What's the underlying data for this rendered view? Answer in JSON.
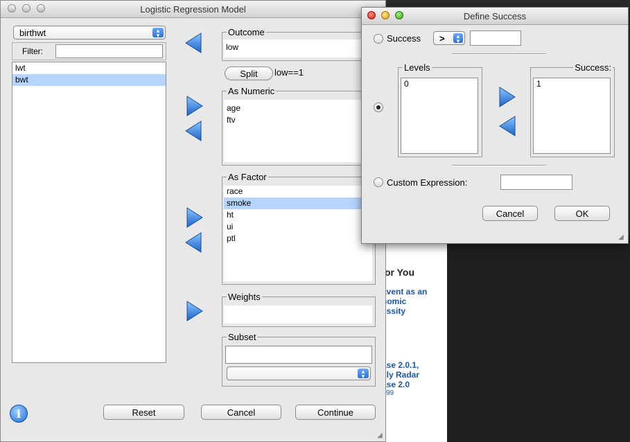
{
  "main_window": {
    "title": "Logistic Regression Model",
    "dataset": "birthwt",
    "filter_label": "Filter:",
    "filter_value": "",
    "variables": [
      "lwt",
      "bwt"
    ],
    "selected_variable": "bwt",
    "outcome": {
      "label": "Outcome",
      "value": "low"
    },
    "split_button": "Split",
    "split_text": "low==1",
    "as_numeric": {
      "label": "As Numeric",
      "items": [
        "age",
        "ftv"
      ]
    },
    "as_factor": {
      "label": "As Factor",
      "items": [
        "race",
        "smoke",
        "ht",
        "ui",
        "ptl"
      ],
      "selected": "smoke"
    },
    "weights": {
      "label": "Weights",
      "value": ""
    },
    "subset": {
      "label": "Subset",
      "value": "",
      "select_value": ""
    },
    "buttons": {
      "reset": "Reset",
      "cancel": "Cancel",
      "continue": "Continue"
    }
  },
  "define_success": {
    "title": "Define Success",
    "success_label": "Success",
    "operator": ">",
    "success_value": "",
    "levels_label": "Levels",
    "levels": [
      "0"
    ],
    "success_list_label": "Success:",
    "success_list": [
      "1"
    ],
    "custom_expression_label": "Custom Expression:",
    "custom_expression_value": "",
    "selected_mode": "levels",
    "buttons": {
      "cancel": "Cancel",
      "ok": "OK"
    }
  },
  "background_window": {
    "heading": "or You",
    "links": [
      "avent as an",
      "nomic",
      "essity",
      "ase 2.0.1,",
      "illy Radar",
      "ase 2.0",
      "99"
    ]
  },
  "colors": {
    "arrow_blue": "#2a7fd6",
    "selection": "#b5d4fe"
  }
}
